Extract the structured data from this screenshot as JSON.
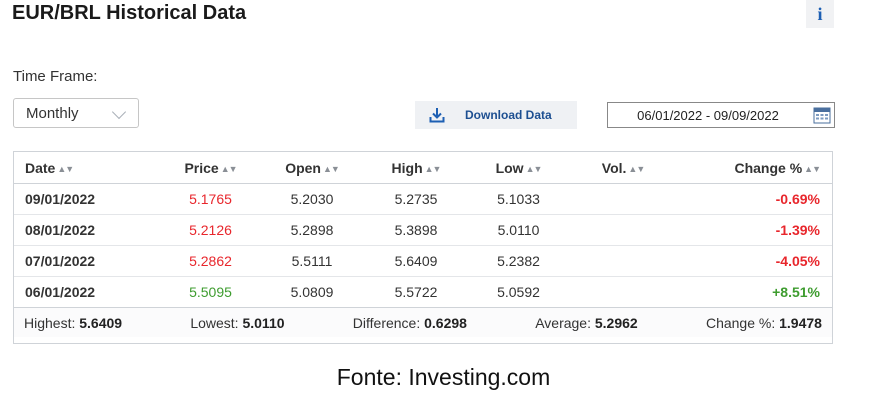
{
  "header": {
    "title": "EUR/BRL Historical Data",
    "info_label": "i"
  },
  "timeframe": {
    "label": "Time Frame:",
    "selected": "Monthly"
  },
  "download": {
    "label": "Download Data"
  },
  "date_range": {
    "value": "06/01/2022 - 09/09/2022"
  },
  "table": {
    "columns": [
      "Date",
      "Price",
      "Open",
      "High",
      "Low",
      "Vol.",
      "Change %"
    ],
    "rows": [
      {
        "date": "09/01/2022",
        "price": "5.1765",
        "open": "5.2030",
        "high": "5.2735",
        "low": "5.1033",
        "vol": "",
        "change": "-0.69%",
        "direction": "down"
      },
      {
        "date": "08/01/2022",
        "price": "5.2126",
        "open": "5.2898",
        "high": "5.3898",
        "low": "5.0110",
        "vol": "",
        "change": "-1.39%",
        "direction": "down"
      },
      {
        "date": "07/01/2022",
        "price": "5.2862",
        "open": "5.5111",
        "high": "5.6409",
        "low": "5.2382",
        "vol": "",
        "change": "-4.05%",
        "direction": "down"
      },
      {
        "date": "06/01/2022",
        "price": "5.5095",
        "open": "5.0809",
        "high": "5.5722",
        "low": "5.0592",
        "vol": "",
        "change": "+8.51%",
        "direction": "up"
      }
    ]
  },
  "summary": {
    "highest_label": "Highest:",
    "highest": "5.6409",
    "lowest_label": "Lowest:",
    "lowest": "5.0110",
    "difference_label": "Difference:",
    "difference": "0.6298",
    "average_label": "Average:",
    "average": "5.2962",
    "change_label": "Change %:",
    "change": "1.9478"
  },
  "source": "Fonte: Investing.com",
  "colors": {
    "down": "#e8262c",
    "up": "#3e9c2f",
    "link": "#1d4f91"
  }
}
